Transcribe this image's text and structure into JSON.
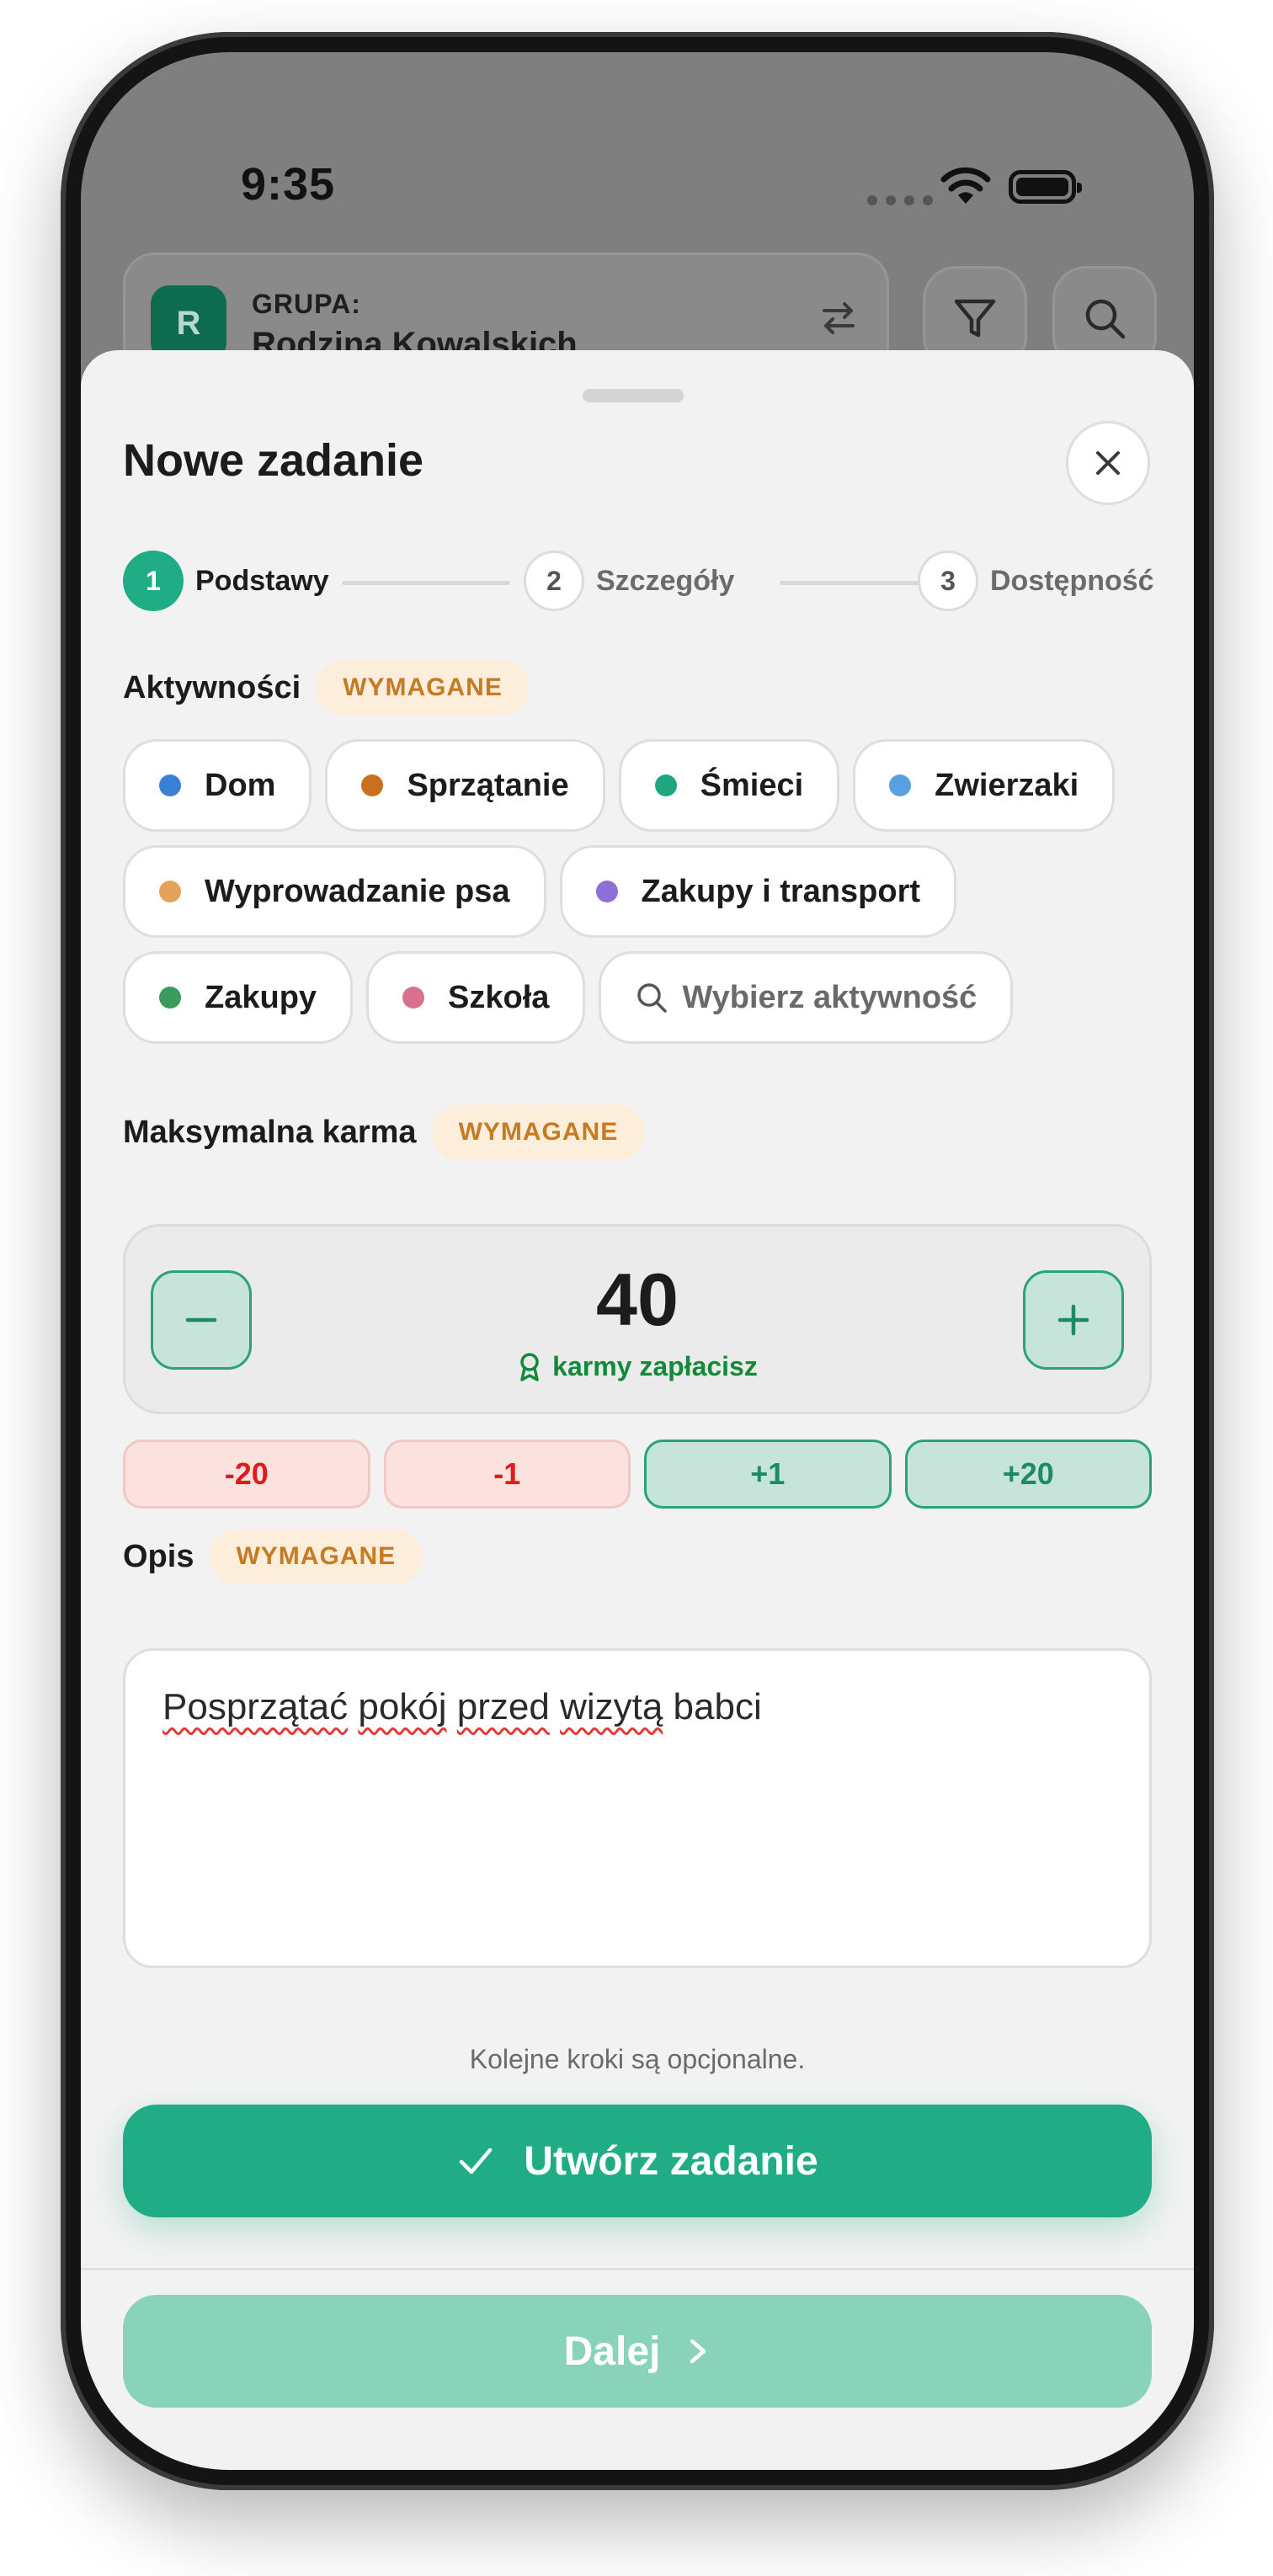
{
  "status_bar": {
    "time": "9:35"
  },
  "background": {
    "group_label": "GRUPA:",
    "group_avatar_letter": "R",
    "group_name": "Rodzina Kowalskich"
  },
  "sheet": {
    "title": "Nowe zadanie",
    "steps": [
      {
        "number": "1",
        "label": "Podstawy",
        "active": true
      },
      {
        "number": "2",
        "label": "Szczegóły",
        "active": false
      },
      {
        "number": "3",
        "label": "Dostępność",
        "active": false
      }
    ],
    "activities": {
      "label": "Aktywności",
      "required_badge": "WYMAGANE",
      "chips": [
        {
          "label": "Dom",
          "color": "#3b7fd4"
        },
        {
          "label": "Sprzątanie",
          "color": "#c96f1e"
        },
        {
          "label": "Śmieci",
          "color": "#1fa680"
        },
        {
          "label": "Zwierzaki",
          "color": "#5aa0e0"
        },
        {
          "label": "Wyprowadzanie psa",
          "color": "#e3a35a"
        },
        {
          "label": "Zakupy i transport",
          "color": "#8e6fd6"
        },
        {
          "label": "Zakupy",
          "color": "#3b9a5d"
        },
        {
          "label": "Szkoła",
          "color": "#d9708e"
        }
      ],
      "search_placeholder": "Wybierz aktywność"
    },
    "karma": {
      "label": "Maksymalna karma",
      "required_badge": "WYMAGANE",
      "value": "40",
      "caption": "karmy zapłacisz",
      "quick_adjust": [
        "-20",
        "-1",
        "+1",
        "+20"
      ]
    },
    "description": {
      "label": "Opis",
      "required_badge": "WYMAGANE",
      "value_misspelled_1": "Posprzątać",
      "value_gap_1": " ",
      "value_misspelled_2": "pokój",
      "value_gap_2": " ",
      "value_misspelled_3": "przed",
      "value_gap_3": " ",
      "value_misspelled_4": "wizytą",
      "value_tail": " babci"
    },
    "hint": "Kolejne kroki są opcjonalne.",
    "create_button": "Utwórz zadanie",
    "next_button": "Dalej"
  },
  "colors": {
    "accent": "#20ad85",
    "required_text": "#c67a24",
    "negative": "#e01b1b",
    "karma_caption": "#138a3a"
  }
}
